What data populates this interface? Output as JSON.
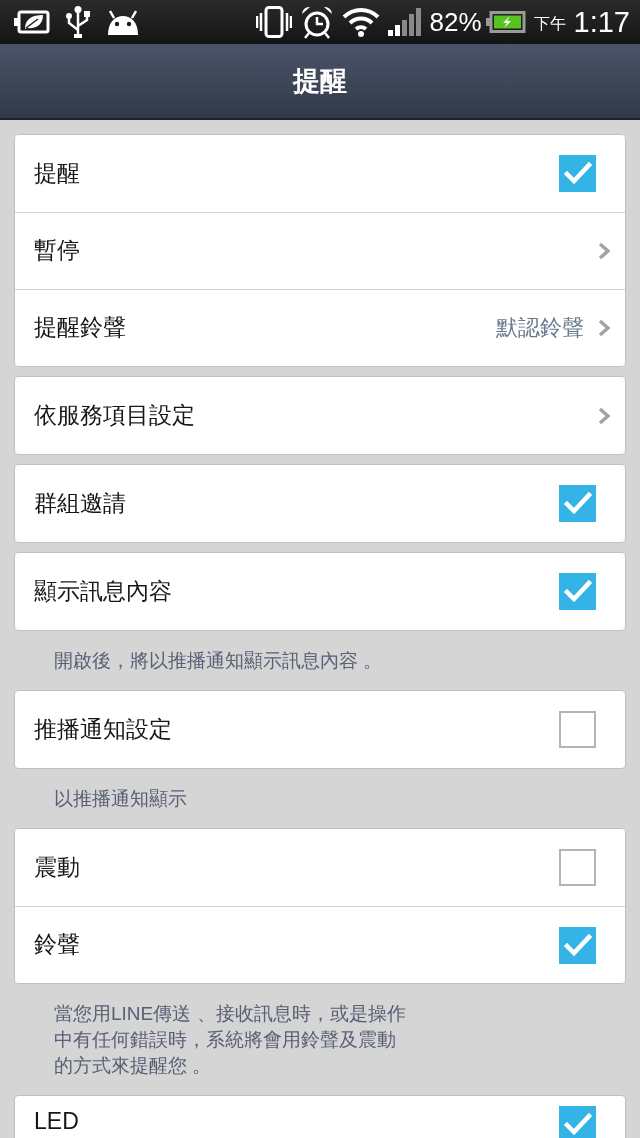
{
  "status_bar": {
    "battery": "82%",
    "period": "下午",
    "time": "1:17"
  },
  "title_bar": {
    "title": "提醒"
  },
  "sections": [
    {
      "rows": [
        {
          "kind": "checkbox",
          "label": "提醒",
          "checked": true
        },
        {
          "kind": "link",
          "label": "暫停"
        },
        {
          "kind": "link",
          "label": "提醒鈴聲",
          "value": "默認鈴聲"
        }
      ]
    },
    {
      "rows": [
        {
          "kind": "link",
          "label": "依服務項目設定"
        }
      ]
    },
    {
      "rows": [
        {
          "kind": "checkbox",
          "label": "群組邀請",
          "checked": true
        }
      ]
    },
    {
      "rows": [
        {
          "kind": "checkbox",
          "label": "顯示訊息內容",
          "checked": true
        }
      ],
      "note": "開啟後，將以推播通知顯示訊息內容 。"
    },
    {
      "rows": [
        {
          "kind": "checkbox",
          "label": "推播通知設定",
          "checked": false
        }
      ],
      "note": "以推播通知顯示"
    },
    {
      "rows": [
        {
          "kind": "checkbox",
          "label": "震動",
          "checked": false
        },
        {
          "kind": "checkbox",
          "label": "鈴聲",
          "checked": true
        }
      ],
      "note": "當您用LINE傳送 、接收訊息時，或是操作中有任何錯誤時，系統將會用鈴聲及震動的方式來提醒您 。"
    },
    {
      "rows": [
        {
          "kind": "checkbox",
          "label": "LED",
          "checked": true
        }
      ]
    }
  ]
}
